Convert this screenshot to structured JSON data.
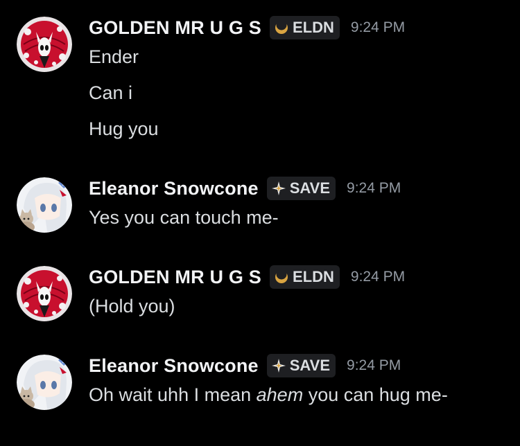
{
  "colors": {
    "background": "#000000",
    "username": "#f2f3f5",
    "message_text": "#dbdee1",
    "timestamp": "#949ba4",
    "tag_background": "#1e1f22"
  },
  "messages": [
    {
      "author": "GOLDEN MR U G S",
      "tag_label": "ELDN",
      "tag_icon": "crescent-moon-icon",
      "timestamp": "9:24 PM",
      "avatar": "red-white-knight-avatar",
      "lines": [
        "Ender",
        "Can i",
        "Hug you"
      ]
    },
    {
      "author": "Eleanor Snowcone",
      "tag_label": "SAVE",
      "tag_icon": "sparkle-diamond-icon",
      "timestamp": "9:24 PM",
      "avatar": "anime-girl-with-cat-avatar",
      "lines": [
        "Yes you can touch me-"
      ]
    },
    {
      "author": "GOLDEN MR U G S",
      "tag_label": "ELDN",
      "tag_icon": "crescent-moon-icon",
      "timestamp": "9:24 PM",
      "avatar": "red-white-knight-avatar",
      "lines": [
        "(Hold you)"
      ]
    },
    {
      "author": "Eleanor Snowcone",
      "tag_label": "SAVE",
      "tag_icon": "sparkle-diamond-icon",
      "timestamp": "9:24 PM",
      "avatar": "anime-girl-with-cat-avatar",
      "line_parts": {
        "before": "Oh wait uhh I mean ",
        "italic": "ahem",
        "after": " you can hug me-"
      }
    }
  ]
}
